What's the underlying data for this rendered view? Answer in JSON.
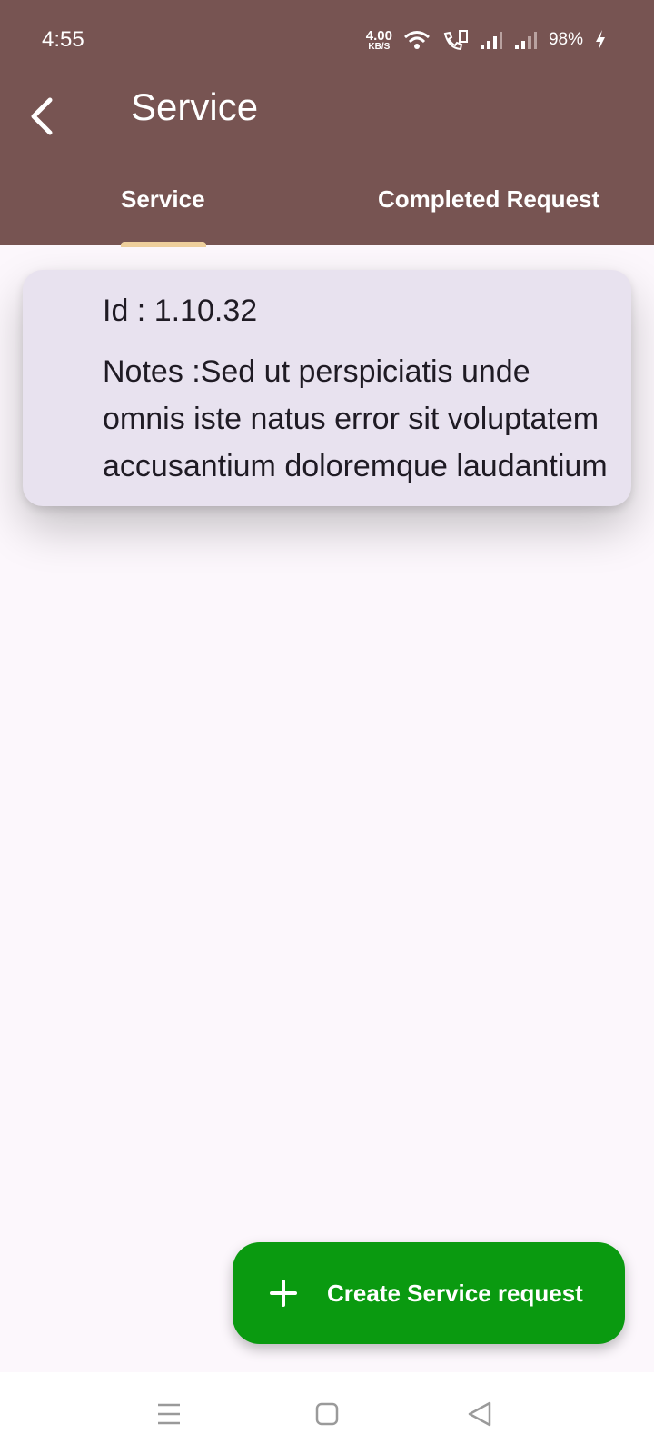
{
  "status_bar": {
    "time": "4:55",
    "speed_value": "4.00",
    "speed_unit": "KB/S",
    "battery": "98%"
  },
  "appbar": {
    "title": "Service"
  },
  "tabs": [
    {
      "label": "Service",
      "selected": true
    },
    {
      "label": "Completed Request",
      "selected": false
    }
  ],
  "card": {
    "id_text": "Id : 1.10.32",
    "notes_text": "Notes :Sed ut perspiciatis unde omnis iste natus error sit voluptatem accusantium doloremque laudantium"
  },
  "fab": {
    "label": "Create Service request"
  },
  "colors": {
    "header": "#775452",
    "tab_indicator": "#eecf9c",
    "card_bg": "#e8e2ef",
    "fab": "#0a9a10",
    "page_bg": "#fcf7fc"
  },
  "icons": {
    "back": "back-arrow-icon",
    "fab": "plus-icon",
    "nav_menu": "menu-icon",
    "nav_home": "home-square-icon",
    "nav_back": "back-triangle-icon"
  }
}
